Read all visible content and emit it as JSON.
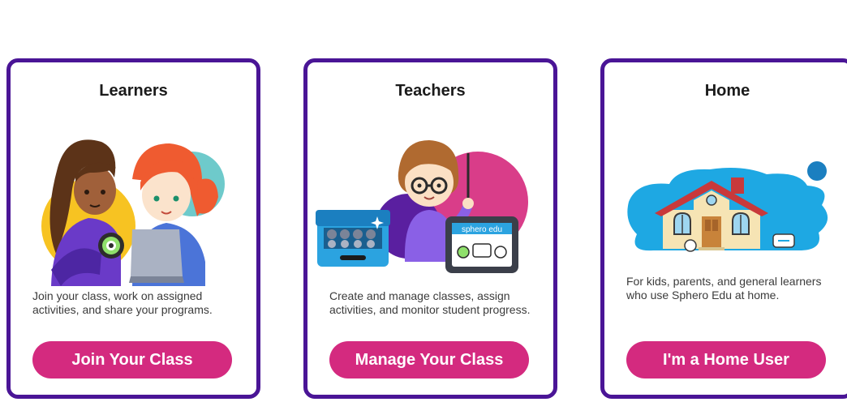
{
  "cards": [
    {
      "title": "Learners",
      "description": "Join your class, work on assigned activities, and share your programs.",
      "button_label": "Join Your Class"
    },
    {
      "title": "Teachers",
      "description": "Create and manage classes, assign activities, and monitor student progress.",
      "button_label": "Manage Your Class"
    },
    {
      "title": "Home",
      "description": "For kids, parents, and general learners who use Sphero Edu at home.",
      "button_label": "I'm a Home User"
    }
  ],
  "illustration_text": {
    "tablet_label": "sphero edu"
  },
  "colors": {
    "card_border": "#4a1596",
    "button": "#d42a7f",
    "button_text": "#ffffff"
  }
}
